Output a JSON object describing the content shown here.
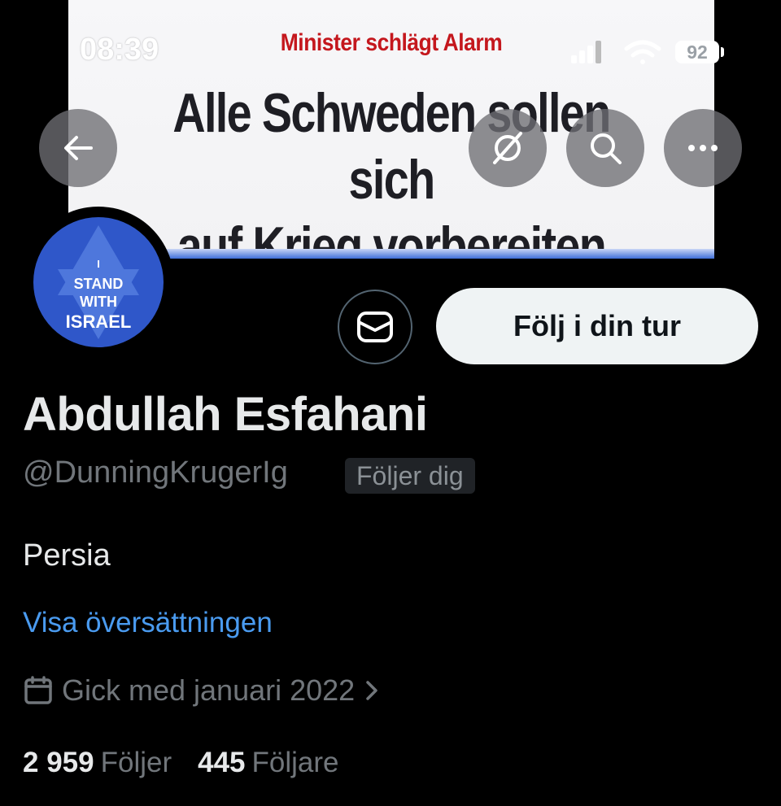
{
  "status_bar": {
    "time": "08:39",
    "battery": "92"
  },
  "banner": {
    "kicker": "Minister schlägt Alarm",
    "headline_line1": "Alle Schweden sollen sich",
    "headline_line2": "auf Krieg vorbereiten"
  },
  "top_actions": {
    "back_icon": "arrow-left-icon",
    "grok_icon": "grok-icon",
    "search_icon": "search-icon",
    "more_icon": "more-horizontal-icon"
  },
  "avatar": {
    "line1": "I",
    "line2": "STAND",
    "line3": "WITH",
    "line4": "ISRAEL"
  },
  "actions": {
    "message_icon": "envelope-icon",
    "follow_label": "Följ i din tur"
  },
  "profile": {
    "name": "Abdullah Esfahani",
    "handle": "@DunningKrugerIg",
    "follows_you": "Följer dig",
    "bio": "Persia",
    "translate_link": "Visa översättningen",
    "joined": "Gick med januari 2022"
  },
  "stats": {
    "following_count": "2 959",
    "following_label": "Följer",
    "followers_count": "445",
    "followers_label": "Följare"
  },
  "colors": {
    "link": "#4a9bf0",
    "secondary_text": "#71767b",
    "background": "#000000",
    "avatar_blue": "#2f57c9"
  }
}
